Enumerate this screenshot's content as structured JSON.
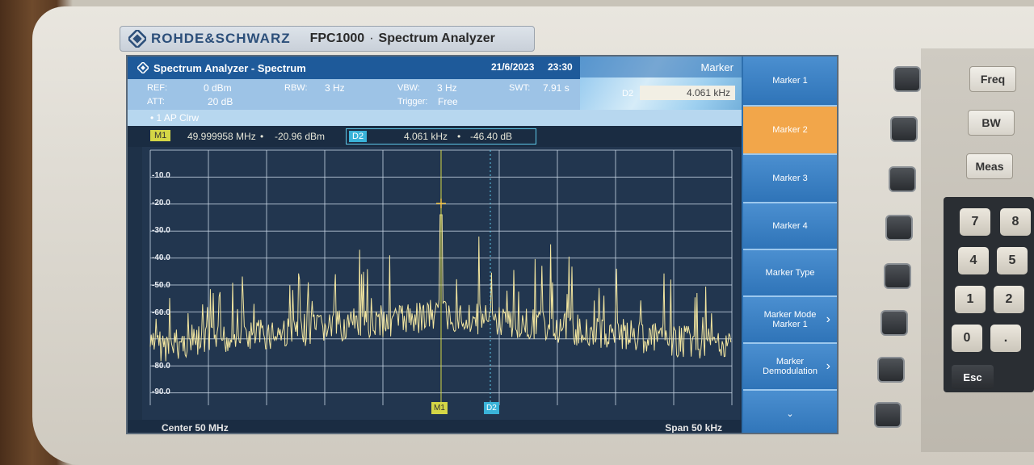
{
  "device": {
    "brand": "ROHDE&SCHWARZ",
    "model": "FPC1000",
    "separator": "·",
    "type": "Spectrum Analyzer"
  },
  "screen": {
    "title": "Spectrum Analyzer - Spectrum",
    "date": "21/6/2023",
    "time": "23:30",
    "panel_header": "Marker",
    "params": {
      "ref_label": "REF:",
      "ref_value": "0 dBm",
      "att_label": "ATT:",
      "att_value": "20 dB",
      "rbw_label": "RBW:",
      "rbw_value": "3 Hz",
      "vbw_label": "VBW:",
      "vbw_value": "3 Hz",
      "swt_label": "SWT:",
      "swt_value": "7.91 s",
      "trigger_label": "Trigger:",
      "trigger_value": "Free"
    },
    "d2_input_label": "D2",
    "d2_input_value": "4.061 kHz",
    "trace_info": "• 1 AP  Clrw",
    "marker_line": {
      "m1_badge": "M1",
      "m1_freq": "49.999958 MHz",
      "m1_level": "-20.96 dBm",
      "d2_badge": "D2",
      "d2_freq": "4.061 kHz",
      "d2_level": "-46.40 dB",
      "bullet": "•"
    },
    "y_ticks": [
      "-10.0",
      "-20.0",
      "-30.0",
      "-40.0",
      "-50.0",
      "-60.0",
      "-80.0",
      "-90.0"
    ],
    "marker_flags": {
      "m1": "M1",
      "d2": "D2"
    },
    "footer": {
      "center": "Center 50 MHz",
      "span": "Span 50 kHz"
    },
    "softkeys": [
      {
        "label": "Marker 1",
        "active": false,
        "chevron": false
      },
      {
        "label": "Marker 2",
        "active": true,
        "chevron": false
      },
      {
        "label": "Marker 3",
        "active": false,
        "chevron": false
      },
      {
        "label": "Marker 4",
        "active": false,
        "chevron": false
      },
      {
        "label": "Marker Type",
        "active": false,
        "chevron": false
      },
      {
        "label": "Marker Mode Marker 1",
        "active": false,
        "chevron": true
      },
      {
        "label": "Marker Demodulation",
        "active": false,
        "chevron": true
      },
      {
        "label": "⌄",
        "active": false,
        "chevron": false
      }
    ],
    "colors": {
      "trace": "#f3e6a0",
      "grid": "#c9d6e6",
      "accent": "#f2a64a",
      "softkey": "#2f74b8"
    }
  },
  "hardware_keys": {
    "freq": "Freq",
    "bw": "BW",
    "meas": "Meas",
    "numpad": [
      {
        "main": "7"
      },
      {
        "main": "8"
      },
      {
        "main": "4"
      },
      {
        "main": "5"
      },
      {
        "main": "1"
      },
      {
        "main": "2"
      },
      {
        "main": "0"
      },
      {
        "main": "."
      }
    ],
    "esc": "Esc"
  }
}
